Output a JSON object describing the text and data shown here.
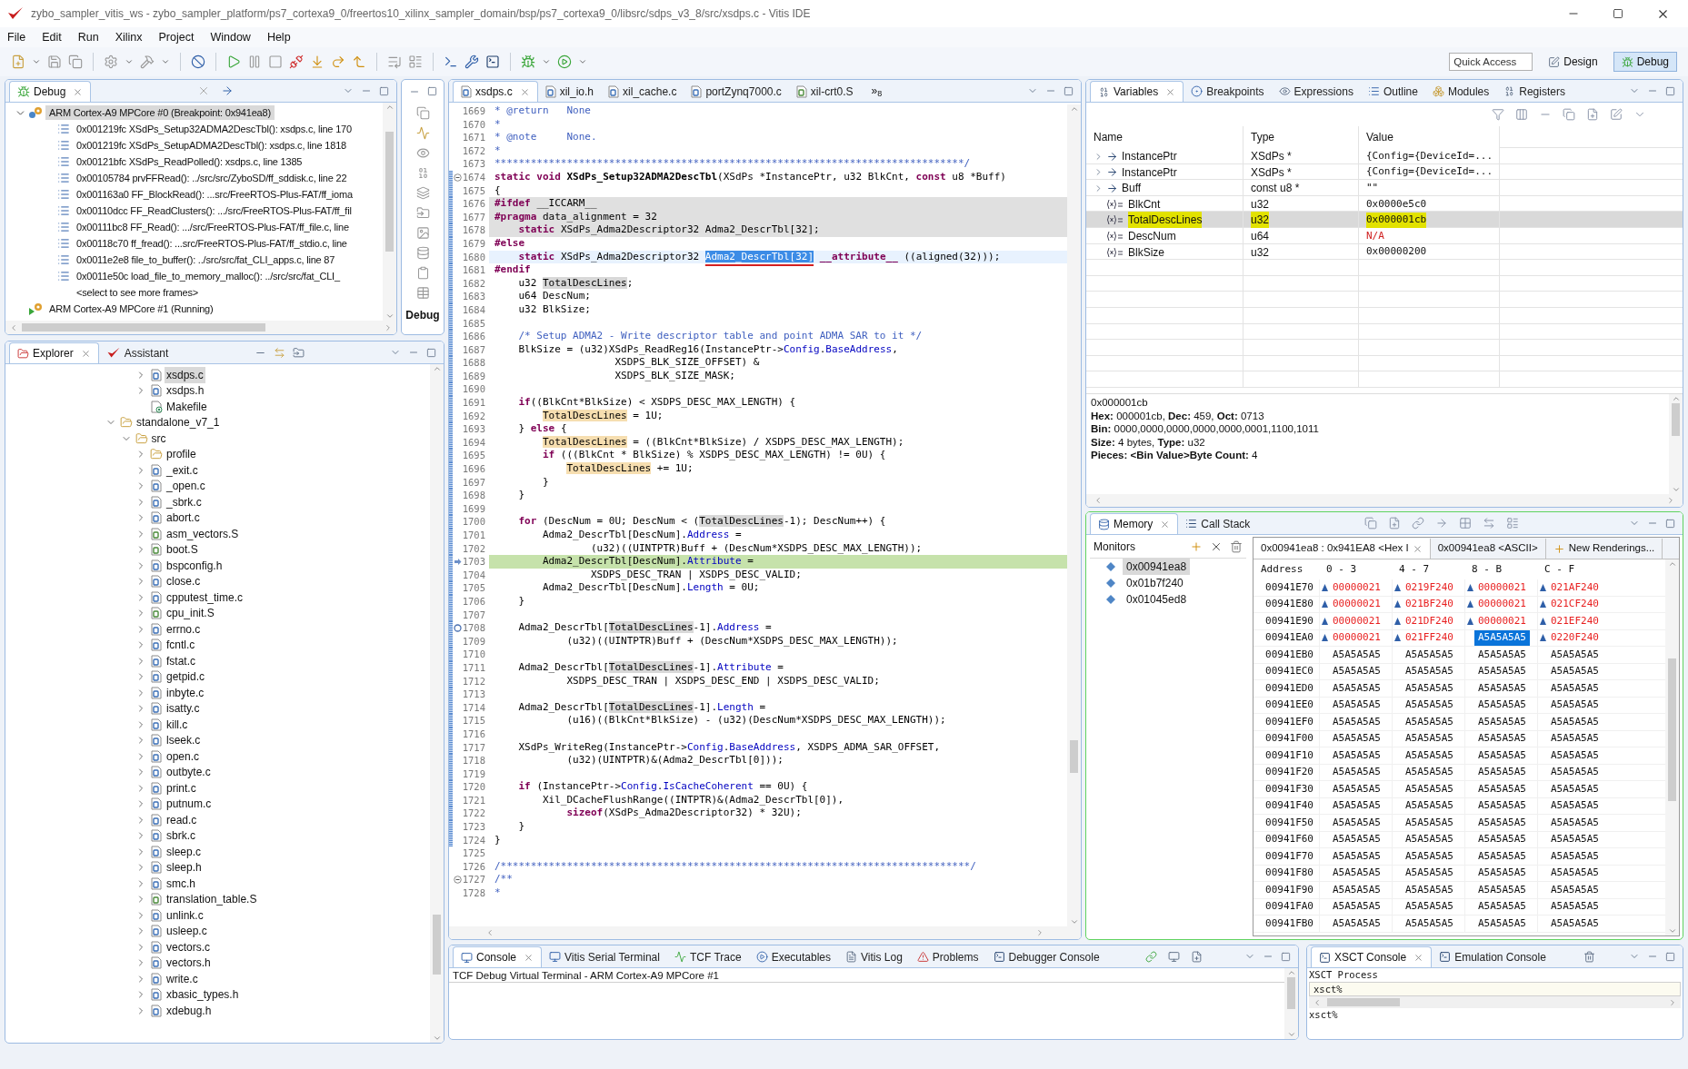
{
  "window": {
    "title": "zybo_sampler_vitis_ws - zybo_sampler_platform/ps7_cortexa9_0/freertos10_xilinx_sampler_domain/bsp/ps7_cortexa9_0/libsrc/sdps_v3_8/src/xsdps.c - Vitis IDE"
  },
  "menu": [
    "File",
    "Edit",
    "Run",
    "Xilinx",
    "Project",
    "Window",
    "Help"
  ],
  "toolbar": {
    "quick_access": "Quick Access",
    "perspectives": [
      {
        "label": "Design",
        "selected": false
      },
      {
        "label": "Debug",
        "selected": true
      }
    ]
  },
  "debug": {
    "tabs": [
      {
        "label": "Debug",
        "selected": true
      }
    ],
    "side_label": "Debug",
    "tree": [
      {
        "label": "ARM Cortex-A9 MPCore #0 (Breakpoint: 0x941ea8)",
        "kind": "suspended",
        "expanded": true,
        "selected": true,
        "children": [
          {
            "label": "0x001219fc XSdPs_Setup32ADMA2DescTbl(): xsdps.c, line 170",
            "kind": "frame",
            "selected": false
          },
          {
            "label": "0x001219fc XSdPs_SetupADMA2DescTbl(): xsdps.c, line 1818",
            "kind": "frame",
            "selected": false
          },
          {
            "label": "0x00121bfc XSdPs_ReadPolled(): xsdps.c, line 1385",
            "kind": "frame",
            "selected": false
          },
          {
            "label": "0x00105784 prvFFRead(): ../src/src/ZyboSD/ff_sddisk.c, line 22",
            "kind": "frame",
            "selected": false
          },
          {
            "label": "0x001163a0 FF_BlockRead(): ...src/FreeRTOS-Plus-FAT/ff_ioma",
            "kind": "frame",
            "selected": false
          },
          {
            "label": "0x00110dcc FF_ReadClusters(): .../src/FreeRTOS-Plus-FAT/ff_fil",
            "kind": "frame",
            "selected": false
          },
          {
            "label": "0x00111bc8 FF_Read(): .../src/FreeRTOS-Plus-FAT/ff_file.c, line",
            "kind": "frame",
            "selected": false
          },
          {
            "label": "0x00118c70 ff_fread(): ...src/FreeRTOS-Plus-FAT/ff_stdio.c, line",
            "kind": "frame",
            "selected": false
          },
          {
            "label": "0x0011e2e8 file_to_buffer(): ../src/src/fat_CLI_apps.c, line 87",
            "kind": "frame",
            "selected": false
          },
          {
            "label": "0x0011e50c load_file_to_memory_malloc(): ../src/src/fat_CLI_",
            "kind": "frame",
            "selected": false
          },
          {
            "label": "<select to see more frames>",
            "kind": "more",
            "selected": false
          }
        ]
      },
      {
        "label": "ARM Cortex-A9 MPCore #1 (Running)",
        "kind": "running",
        "selected": false
      }
    ]
  },
  "explorer": {
    "tabs": [
      {
        "label": "Explorer",
        "selected": true
      },
      {
        "label": "Assistant",
        "selected": false
      }
    ],
    "tree": [
      {
        "children": [
          {
            "children": [
              {
                "label": "xsdps.c",
                "kind": "source",
                "expanded": false,
                "selected": true
              },
              {
                "label": "xsdps.h",
                "kind": "header",
                "expanded": false,
                "selected": false
              },
              {
                "label": "Makefile",
                "kind": "makefile",
                "selected": false
              }
            ]
          }
        ]
      },
      {
        "label": "standalone_v7_1",
        "kind": "folder",
        "expanded": true,
        "selected": false,
        "children": [
          {
            "label": "src",
            "kind": "folder",
            "expanded": true,
            "selected": false,
            "children": [
              {
                "label": "profile",
                "kind": "folder",
                "expanded": false,
                "selected": false
              },
              {
                "label": "_exit.c",
                "kind": "source",
                "expanded": false,
                "selected": false
              },
              {
                "label": "_open.c",
                "kind": "source",
                "expanded": false,
                "selected": false
              },
              {
                "label": "_sbrk.c",
                "kind": "source",
                "expanded": false,
                "selected": false
              },
              {
                "label": "abort.c",
                "kind": "source",
                "expanded": false,
                "selected": false
              },
              {
                "label": "asm_vectors.S",
                "kind": "asm",
                "expanded": false,
                "selected": false
              },
              {
                "label": "boot.S",
                "kind": "asm",
                "expanded": false,
                "selected": false
              },
              {
                "label": "bspconfig.h",
                "kind": "header",
                "expanded": false,
                "selected": false
              },
              {
                "label": "close.c",
                "kind": "source",
                "expanded": false,
                "selected": false
              },
              {
                "label": "cpputest_time.c",
                "kind": "source",
                "expanded": false,
                "selected": false
              },
              {
                "label": "cpu_init.S",
                "kind": "asm",
                "expanded": false,
                "selected": false
              },
              {
                "label": "errno.c",
                "kind": "source",
                "expanded": false,
                "selected": false
              },
              {
                "label": "fcntl.c",
                "kind": "source",
                "expanded": false,
                "selected": false
              },
              {
                "label": "fstat.c",
                "kind": "source",
                "expanded": false,
                "selected": false
              },
              {
                "label": "getpid.c",
                "kind": "source",
                "expanded": false,
                "selected": false
              },
              {
                "label": "inbyte.c",
                "kind": "source",
                "expanded": false,
                "selected": false
              },
              {
                "label": "isatty.c",
                "kind": "source",
                "expanded": false,
                "selected": false
              },
              {
                "label": "kill.c",
                "kind": "source",
                "expanded": false,
                "selected": false
              },
              {
                "label": "lseek.c",
                "kind": "source",
                "expanded": false,
                "selected": false
              },
              {
                "label": "open.c",
                "kind": "source",
                "expanded": false,
                "selected": false
              },
              {
                "label": "outbyte.c",
                "kind": "source",
                "expanded": false,
                "selected": false
              },
              {
                "label": "print.c",
                "kind": "source",
                "expanded": false,
                "selected": false
              },
              {
                "label": "putnum.c",
                "kind": "source",
                "expanded": false,
                "selected": false
              },
              {
                "label": "read.c",
                "kind": "source",
                "expanded": false,
                "selected": false
              },
              {
                "label": "sbrk.c",
                "kind": "source",
                "expanded": false,
                "selected": false
              },
              {
                "label": "sleep.c",
                "kind": "source",
                "expanded": false,
                "selected": false
              },
              {
                "label": "sleep.h",
                "kind": "header",
                "expanded": false,
                "selected": false
              },
              {
                "label": "smc.h",
                "kind": "header",
                "expanded": false,
                "selected": false
              },
              {
                "label": "translation_table.S",
                "kind": "asm",
                "expanded": false,
                "selected": false
              },
              {
                "label": "unlink.c",
                "kind": "source",
                "expanded": false,
                "selected": false
              },
              {
                "label": "usleep.c",
                "kind": "source",
                "expanded": false,
                "selected": false
              },
              {
                "label": "vectors.c",
                "kind": "source",
                "expanded": false,
                "selected": false
              },
              {
                "label": "vectors.h",
                "kind": "header",
                "expanded": false,
                "selected": false
              },
              {
                "label": "write.c",
                "kind": "source",
                "expanded": false,
                "selected": false
              },
              {
                "label": "xbasic_types.h",
                "kind": "header",
                "expanded": false,
                "selected": false
              },
              {
                "label": "xdebug.h",
                "kind": "header",
                "expanded": false,
                "selected": false
              }
            ]
          }
        ]
      }
    ]
  },
  "editor": {
    "tabs": [
      {
        "label": "xsdps.c",
        "kind": "source",
        "selected": true
      },
      {
        "label": "xil_io.h",
        "kind": "header",
        "selected": false
      },
      {
        "label": "xil_cache.c",
        "kind": "source",
        "selected": false
      },
      {
        "label": "portZynq7000.c",
        "kind": "source",
        "selected": false
      },
      {
        "label": "xil-crt0.S",
        "kind": "asm",
        "selected": false
      }
    ],
    "overflow": {
      "mark": "»",
      "count": "8"
    },
    "lines": [
      {
        "n": "1669",
        "parts": [
          {
            "t": "* @return   None",
            "kind": "cm"
          }
        ]
      },
      {
        "n": "1670",
        "parts": [
          {
            "t": "*",
            "kind": "cm"
          }
        ]
      },
      {
        "n": "1671",
        "parts": [
          {
            "t": "* @note     None.",
            "kind": "cm"
          }
        ]
      },
      {
        "n": "1672",
        "parts": [
          {
            "t": "*",
            "kind": "cm"
          }
        ]
      },
      {
        "n": "1673",
        "parts": [
          {
            "t": "******************************************************************************/",
            "kind": "cm"
          }
        ]
      },
      {
        "n": "1674",
        "fold": true,
        "scope": true,
        "parts": [
          {
            "t": "static void ",
            "kind": "kw"
          },
          {
            "t": "XSdPs_Setup32ADMA2DescTbl",
            "kind": "fn"
          },
          {
            "t": "(XSdPs *InstancePtr, u32 BlkCnt, "
          },
          {
            "t": "const",
            "kind": "kw"
          },
          {
            "t": " u8 *Buff)"
          }
        ]
      },
      {
        "n": "1675",
        "scope": true,
        "parts": [
          {
            "t": "{"
          }
        ]
      },
      {
        "n": "1676",
        "scope": true,
        "inactive": true,
        "parts": [
          {
            "t": "#ifdef",
            "kind": "pp"
          },
          {
            "t": " __ICCARM__"
          }
        ]
      },
      {
        "n": "1677",
        "scope": true,
        "inactive": true,
        "parts": [
          {
            "t": "#pragma",
            "kind": "pp"
          },
          {
            "t": " data_alignment = 32"
          }
        ]
      },
      {
        "n": "1678",
        "scope": true,
        "inactive": true,
        "parts": [
          {
            "t": "    static",
            "kind": "kw"
          },
          {
            "t": " XSdPs_Adma2Descriptor32 Adma2_DescrTbl[32];"
          }
        ]
      },
      {
        "n": "1679",
        "scope": true,
        "parts": [
          {
            "t": "#else",
            "kind": "pp"
          }
        ]
      },
      {
        "n": "1680",
        "scope": true,
        "cursor": true,
        "parts": [
          {
            "t": "    static",
            "kind": "kw"
          },
          {
            "t": " XSdPs_Adma2Descriptor32 "
          },
          {
            "t": "Adma2_DescrTbl[32]",
            "kind": "sel",
            "underlined": true
          },
          {
            "t": " __attribute__",
            "kind": "kw"
          },
          {
            "t": " ((aligned(32)));"
          }
        ]
      },
      {
        "n": "1681",
        "scope": true,
        "parts": [
          {
            "t": "#endif",
            "kind": "pp"
          }
        ]
      },
      {
        "n": "1682",
        "scope": true,
        "parts": [
          {
            "t": "    u32 "
          },
          {
            "t": "TotalDescLines",
            "kind": "rd"
          },
          {
            "t": ";"
          }
        ]
      },
      {
        "n": "1683",
        "scope": true,
        "parts": [
          {
            "t": "    u64 DescNum;"
          }
        ]
      },
      {
        "n": "1684",
        "scope": true,
        "parts": [
          {
            "t": "    u32 BlkSize;"
          }
        ]
      },
      {
        "n": "1685",
        "scope": true
      },
      {
        "n": "1686",
        "scope": true,
        "parts": [
          {
            "t": "    /* Setup ADMA2 - Write descriptor table and point ADMA SAR to it */",
            "kind": "cm"
          }
        ]
      },
      {
        "n": "1687",
        "scope": true,
        "parts": [
          {
            "t": "    BlkSize = (u32)XSdPs_ReadReg16(InstancePtr->"
          },
          {
            "t": "Config",
            "kind": "fld"
          },
          {
            "t": "."
          },
          {
            "t": "BaseAddress",
            "kind": "fld"
          },
          {
            "t": ","
          }
        ]
      },
      {
        "n": "1688",
        "scope": true,
        "parts": [
          {
            "t": "                    XSDPS_BLK_SIZE_OFFSET) &"
          }
        ]
      },
      {
        "n": "1689",
        "scope": true,
        "parts": [
          {
            "t": "                    XSDPS_BLK_SIZE_MASK;"
          }
        ]
      },
      {
        "n": "1690",
        "scope": true
      },
      {
        "n": "1691",
        "scope": true,
        "parts": [
          {
            "t": "    if",
            "kind": "kw"
          },
          {
            "t": "((BlkCnt*BlkSize) < XSDPS_DESC_MAX_LENGTH) {"
          }
        ]
      },
      {
        "n": "1692",
        "scope": true,
        "parts": [
          {
            "t": "        TotalDescLines",
            "kind": "occ"
          },
          {
            "t": " = 1U;"
          }
        ]
      },
      {
        "n": "1693",
        "scope": true,
        "parts": [
          {
            "t": "    } "
          },
          {
            "t": "else",
            "kind": "kw"
          },
          {
            "t": " {"
          }
        ]
      },
      {
        "n": "1694",
        "scope": true,
        "parts": [
          {
            "t": "        TotalDescLines",
            "kind": "occ"
          },
          {
            "t": " = ((BlkCnt*BlkSize) / XSDPS_DESC_MAX_LENGTH);"
          }
        ]
      },
      {
        "n": "1695",
        "scope": true,
        "parts": [
          {
            "t": "        if",
            "kind": "kw"
          },
          {
            "t": " (((BlkCnt * BlkSize) % XSDPS_DESC_MAX_LENGTH) != 0U) {"
          }
        ]
      },
      {
        "n": "1696",
        "scope": true,
        "parts": [
          {
            "t": "            TotalDescLines",
            "kind": "occ"
          },
          {
            "t": " += 1U;"
          }
        ]
      },
      {
        "n": "1697",
        "scope": true,
        "parts": [
          {
            "t": "        }"
          }
        ]
      },
      {
        "n": "1698",
        "scope": true,
        "parts": [
          {
            "t": "    }"
          }
        ]
      },
      {
        "n": "1699",
        "scope": true
      },
      {
        "n": "1700",
        "scope": true,
        "parts": [
          {
            "t": "    for",
            "kind": "kw"
          },
          {
            "t": " (DescNum = 0U; DescNum < ("
          },
          {
            "t": "TotalDescLines",
            "kind": "rd"
          },
          {
            "t": "-1); DescNum++) {"
          }
        ]
      },
      {
        "n": "1701",
        "scope": true,
        "parts": [
          {
            "t": "        Adma2_DescrTbl[DescNum]."
          },
          {
            "t": "Address",
            "kind": "fld"
          },
          {
            "t": " ="
          }
        ]
      },
      {
        "n": "1702",
        "scope": true,
        "parts": [
          {
            "t": "                (u32)((UINTPTR)Buff + (DescNum*XSDPS_DESC_MAX_LENGTH));"
          }
        ]
      },
      {
        "n": "1703",
        "scope": true,
        "pointer": true,
        "current": true,
        "parts": [
          {
            "t": "        Adma2_DescrTbl[DescNum]."
          },
          {
            "t": "Attribute",
            "kind": "fld"
          },
          {
            "t": " ="
          }
        ]
      },
      {
        "n": "1704",
        "scope": true,
        "parts": [
          {
            "t": "                XSDPS_DESC_TRAN | XSDPS_DESC_VALID;"
          }
        ]
      },
      {
        "n": "1705",
        "scope": true,
        "parts": [
          {
            "t": "        Adma2_DescrTbl[DescNum]."
          },
          {
            "t": "Length",
            "kind": "fld"
          },
          {
            "t": " = 0U;"
          }
        ]
      },
      {
        "n": "1706",
        "scope": true,
        "parts": [
          {
            "t": "    }"
          }
        ]
      },
      {
        "n": "1707",
        "scope": true
      },
      {
        "n": "1708",
        "scope": true,
        "breakpoint": true,
        "parts": [
          {
            "t": "    Adma2_DescrTbl["
          },
          {
            "t": "TotalDescLines",
            "kind": "rd"
          },
          {
            "t": "-1]."
          },
          {
            "t": "Address",
            "kind": "fld"
          },
          {
            "t": " ="
          }
        ]
      },
      {
        "n": "1709",
        "scope": true,
        "parts": [
          {
            "t": "            (u32)((UINTPTR)Buff + (DescNum*XSDPS_DESC_MAX_LENGTH));"
          }
        ]
      },
      {
        "n": "1710",
        "scope": true
      },
      {
        "n": "1711",
        "scope": true,
        "parts": [
          {
            "t": "    Adma2_DescrTbl["
          },
          {
            "t": "TotalDescLines",
            "kind": "rd"
          },
          {
            "t": "-1]."
          },
          {
            "t": "Attribute",
            "kind": "fld"
          },
          {
            "t": " ="
          }
        ]
      },
      {
        "n": "1712",
        "scope": true,
        "parts": [
          {
            "t": "            XSDPS_DESC_TRAN | XSDPS_DESC_END | XSDPS_DESC_VALID;"
          }
        ]
      },
      {
        "n": "1713",
        "scope": true
      },
      {
        "n": "1714",
        "scope": true,
        "parts": [
          {
            "t": "    Adma2_DescrTbl["
          },
          {
            "t": "TotalDescLines",
            "kind": "rd"
          },
          {
            "t": "-1]."
          },
          {
            "t": "Length",
            "kind": "fld"
          },
          {
            "t": " ="
          }
        ]
      },
      {
        "n": "1715",
        "scope": true,
        "parts": [
          {
            "t": "            (u16)((BlkCnt*BlkSize) - (u32)(DescNum*XSDPS_DESC_MAX_LENGTH));"
          }
        ]
      },
      {
        "n": "1716",
        "scope": true
      },
      {
        "n": "1717",
        "scope": true,
        "parts": [
          {
            "t": "    XSdPs_WriteReg(InstancePtr->"
          },
          {
            "t": "Config",
            "kind": "fld"
          },
          {
            "t": "."
          },
          {
            "t": "BaseAddress",
            "kind": "fld"
          },
          {
            "t": ", XSDPS_ADMA_SAR_OFFSET,"
          }
        ]
      },
      {
        "n": "1718",
        "scope": true,
        "parts": [
          {
            "t": "            (u32)(UINTPTR)&(Adma2_DescrTbl[0]));"
          }
        ]
      },
      {
        "n": "1719",
        "scope": true
      },
      {
        "n": "1720",
        "scope": true,
        "parts": [
          {
            "t": "    if",
            "kind": "kw"
          },
          {
            "t": " (InstancePtr->"
          },
          {
            "t": "Config",
            "kind": "fld"
          },
          {
            "t": "."
          },
          {
            "t": "IsCacheCoherent",
            "kind": "fld"
          },
          {
            "t": " == 0U) {"
          }
        ]
      },
      {
        "n": "1721",
        "scope": true,
        "parts": [
          {
            "t": "        Xil_DCacheFlushRange((INTPTR)&(Adma2_DescrTbl[0]),"
          }
        ]
      },
      {
        "n": "1722",
        "scope": true,
        "parts": [
          {
            "t": "            sizeof",
            "kind": "kw"
          },
          {
            "t": "(XSdPs_Adma2Descriptor32) * 32U);"
          }
        ]
      },
      {
        "n": "1723",
        "scope": true,
        "parts": [
          {
            "t": "    }"
          }
        ]
      },
      {
        "n": "1724",
        "scope": true,
        "parts": [
          {
            "t": "}"
          }
        ]
      },
      {
        "n": "1725"
      },
      {
        "n": "1726",
        "parts": [
          {
            "t": "/******************************************************************************/",
            "kind": "cm"
          }
        ]
      },
      {
        "n": "1727",
        "fold": true,
        "parts": [
          {
            "t": "/**",
            "kind": "cm"
          }
        ]
      },
      {
        "n": "1728",
        "parts": [
          {
            "t": "*",
            "kind": "cm"
          }
        ]
      }
    ]
  },
  "variables": {
    "tabs": [
      {
        "label": "Variables",
        "selected": true
      },
      {
        "label": "Breakpoints",
        "selected": false
      },
      {
        "label": "Expressions",
        "selected": false
      },
      {
        "label": "Outline",
        "selected": false
      },
      {
        "label": "Modules",
        "selected": false
      },
      {
        "label": "Registers",
        "selected": false
      }
    ],
    "columns": [
      "Name",
      "Type",
      "Value"
    ],
    "rows": [
      {
        "name": "InstancePtr",
        "type": "XSdPs *",
        "value": "{Config={DeviceId=...",
        "kind": "pointer",
        "expanded": false,
        "selected": false,
        "marked": false,
        "error": false
      },
      {
        "name": "InstancePtr",
        "type": "XSdPs *",
        "value": "{Config={DeviceId=...",
        "kind": "pointer",
        "expanded": false,
        "selected": false,
        "marked": false,
        "error": false
      },
      {
        "name": "Buff",
        "type": "const u8 *",
        "value": "\"\"",
        "kind": "pointer",
        "expanded": false,
        "selected": false,
        "marked": false,
        "error": false
      },
      {
        "name": "BlkCnt",
        "type": "u32",
        "value": "0x0000e5c0",
        "kind": "scalar",
        "selected": false,
        "marked": false,
        "error": false
      },
      {
        "name": "TotalDescLines",
        "type": "u32",
        "value": "0x000001cb",
        "kind": "scalar",
        "selected": true,
        "marked": true,
        "error": false
      },
      {
        "name": "DescNum",
        "type": "u64",
        "value": "N/A",
        "kind": "scalar",
        "selected": false,
        "marked": false,
        "error": true
      },
      {
        "name": "BlkSize",
        "type": "u32",
        "value": "0x00000200",
        "kind": "scalar",
        "selected": false,
        "marked": false,
        "error": false
      }
    ],
    "details": [
      "0x000001cb",
      "**Hex:** 000001cb, **Dec:** 459, **Oct:** 0713",
      "**Bin:** 0000,0000,0000,0000,0000,0001,1100,1011",
      "**Size:** 4 bytes, **Type:** u32",
      "**Pieces: <Bin Value>Byte Count:** 4"
    ]
  },
  "memory": {
    "active": true,
    "tabs": [
      {
        "label": "Memory",
        "selected": true
      },
      {
        "label": "Call Stack",
        "selected": false
      }
    ],
    "monitors_label": "Monitors",
    "monitors": [
      {
        "label": "0x00941ea8",
        "selected": true
      },
      {
        "label": "0x01b7f240",
        "selected": false
      },
      {
        "label": "0x01045ed8",
        "selected": false
      }
    ],
    "renderings": [
      {
        "label": "0x00941ea8 : 0x941EA8 <Hex I",
        "kind": "rendering",
        "selected": true
      },
      {
        "label": "0x00941ea8 <ASCII>",
        "kind": "rendering",
        "selected": false
      },
      {
        "label": "New Renderings...",
        "kind": "add",
        "selected": false
      }
    ],
    "address_column": "Address",
    "columns": [
      "0 - 3",
      "4 - 7",
      "8 - B",
      "C - F"
    ],
    "rows": [
      {
        "address": "00941E70",
        "cells": [
          {
            "text": "00000021",
            "changed": true,
            "selected": false
          },
          {
            "text": "0219F240",
            "changed": true,
            "selected": false
          },
          {
            "text": "00000021",
            "changed": true,
            "selected": false
          },
          {
            "text": "021AF240",
            "changed": true,
            "selected": false
          }
        ]
      },
      {
        "address": "00941E80",
        "cells": [
          {
            "text": "00000021",
            "changed": true,
            "selected": false
          },
          {
            "text": "021BF240",
            "changed": true,
            "selected": false
          },
          {
            "text": "00000021",
            "changed": true,
            "selected": false
          },
          {
            "text": "021CF240",
            "changed": true,
            "selected": false
          }
        ]
      },
      {
        "address": "00941E90",
        "cells": [
          {
            "text": "00000021",
            "changed": true,
            "selected": false
          },
          {
            "text": "021DF240",
            "changed": true,
            "selected": false
          },
          {
            "text": "00000021",
            "changed": true,
            "selected": false
          },
          {
            "text": "021EF240",
            "changed": true,
            "selected": false
          }
        ]
      },
      {
        "address": "00941EA0",
        "cells": [
          {
            "text": "00000021",
            "changed": true,
            "selected": false
          },
          {
            "text": "021FF240",
            "changed": true,
            "selected": false
          },
          {
            "text": "A5A5A5A5",
            "changed": false,
            "selected": true
          },
          {
            "text": "0220F240",
            "changed": true,
            "selected": false
          }
        ]
      },
      {
        "address": "00941EB0",
        "cells": [
          {
            "text": "A5A5A5A5",
            "changed": false,
            "selected": false
          },
          {
            "text": "A5A5A5A5",
            "changed": false,
            "selected": false
          },
          {
            "text": "A5A5A5A5",
            "changed": false,
            "selected": false
          },
          {
            "text": "A5A5A5A5",
            "changed": false,
            "selected": false
          }
        ]
      },
      {
        "address": "00941EC0",
        "cells": [
          {
            "text": "A5A5A5A5",
            "changed": false,
            "selected": false
          },
          {
            "text": "A5A5A5A5",
            "changed": false,
            "selected": false
          },
          {
            "text": "A5A5A5A5",
            "changed": false,
            "selected": false
          },
          {
            "text": "A5A5A5A5",
            "changed": false,
            "selected": false
          }
        ]
      },
      {
        "address": "00941ED0",
        "cells": [
          {
            "text": "A5A5A5A5",
            "changed": false,
            "selected": false
          },
          {
            "text": "A5A5A5A5",
            "changed": false,
            "selected": false
          },
          {
            "text": "A5A5A5A5",
            "changed": false,
            "selected": false
          },
          {
            "text": "A5A5A5A5",
            "changed": false,
            "selected": false
          }
        ]
      },
      {
        "address": "00941EE0",
        "cells": [
          {
            "text": "A5A5A5A5",
            "changed": false,
            "selected": false
          },
          {
            "text": "A5A5A5A5",
            "changed": false,
            "selected": false
          },
          {
            "text": "A5A5A5A5",
            "changed": false,
            "selected": false
          },
          {
            "text": "A5A5A5A5",
            "changed": false,
            "selected": false
          }
        ]
      },
      {
        "address": "00941EF0",
        "cells": [
          {
            "text": "A5A5A5A5",
            "changed": false,
            "selected": false
          },
          {
            "text": "A5A5A5A5",
            "changed": false,
            "selected": false
          },
          {
            "text": "A5A5A5A5",
            "changed": false,
            "selected": false
          },
          {
            "text": "A5A5A5A5",
            "changed": false,
            "selected": false
          }
        ]
      },
      {
        "address": "00941F00",
        "cells": [
          {
            "text": "A5A5A5A5",
            "changed": false,
            "selected": false
          },
          {
            "text": "A5A5A5A5",
            "changed": false,
            "selected": false
          },
          {
            "text": "A5A5A5A5",
            "changed": false,
            "selected": false
          },
          {
            "text": "A5A5A5A5",
            "changed": false,
            "selected": false
          }
        ]
      },
      {
        "address": "00941F10",
        "cells": [
          {
            "text": "A5A5A5A5",
            "changed": false,
            "selected": false
          },
          {
            "text": "A5A5A5A5",
            "changed": false,
            "selected": false
          },
          {
            "text": "A5A5A5A5",
            "changed": false,
            "selected": false
          },
          {
            "text": "A5A5A5A5",
            "changed": false,
            "selected": false
          }
        ]
      },
      {
        "address": "00941F20",
        "cells": [
          {
            "text": "A5A5A5A5",
            "changed": false,
            "selected": false
          },
          {
            "text": "A5A5A5A5",
            "changed": false,
            "selected": false
          },
          {
            "text": "A5A5A5A5",
            "changed": false,
            "selected": false
          },
          {
            "text": "A5A5A5A5",
            "changed": false,
            "selected": false
          }
        ]
      },
      {
        "address": "00941F30",
        "cells": [
          {
            "text": "A5A5A5A5",
            "changed": false,
            "selected": false
          },
          {
            "text": "A5A5A5A5",
            "changed": false,
            "selected": false
          },
          {
            "text": "A5A5A5A5",
            "changed": false,
            "selected": false
          },
          {
            "text": "A5A5A5A5",
            "changed": false,
            "selected": false
          }
        ]
      },
      {
        "address": "00941F40",
        "cells": [
          {
            "text": "A5A5A5A5",
            "changed": false,
            "selected": false
          },
          {
            "text": "A5A5A5A5",
            "changed": false,
            "selected": false
          },
          {
            "text": "A5A5A5A5",
            "changed": false,
            "selected": false
          },
          {
            "text": "A5A5A5A5",
            "changed": false,
            "selected": false
          }
        ]
      },
      {
        "address": "00941F50",
        "cells": [
          {
            "text": "A5A5A5A5",
            "changed": false,
            "selected": false
          },
          {
            "text": "A5A5A5A5",
            "changed": false,
            "selected": false
          },
          {
            "text": "A5A5A5A5",
            "changed": false,
            "selected": false
          },
          {
            "text": "A5A5A5A5",
            "changed": false,
            "selected": false
          }
        ]
      },
      {
        "address": "00941F60",
        "cells": [
          {
            "text": "A5A5A5A5",
            "changed": false,
            "selected": false
          },
          {
            "text": "A5A5A5A5",
            "changed": false,
            "selected": false
          },
          {
            "text": "A5A5A5A5",
            "changed": false,
            "selected": false
          },
          {
            "text": "A5A5A5A5",
            "changed": false,
            "selected": false
          }
        ]
      },
      {
        "address": "00941F70",
        "cells": [
          {
            "text": "A5A5A5A5",
            "changed": false,
            "selected": false
          },
          {
            "text": "A5A5A5A5",
            "changed": false,
            "selected": false
          },
          {
            "text": "A5A5A5A5",
            "changed": false,
            "selected": false
          },
          {
            "text": "A5A5A5A5",
            "changed": false,
            "selected": false
          }
        ]
      },
      {
        "address": "00941F80",
        "cells": [
          {
            "text": "A5A5A5A5",
            "changed": false,
            "selected": false
          },
          {
            "text": "A5A5A5A5",
            "changed": false,
            "selected": false
          },
          {
            "text": "A5A5A5A5",
            "changed": false,
            "selected": false
          },
          {
            "text": "A5A5A5A5",
            "changed": false,
            "selected": false
          }
        ]
      },
      {
        "address": "00941F90",
        "cells": [
          {
            "text": "A5A5A5A5",
            "changed": false,
            "selected": false
          },
          {
            "text": "A5A5A5A5",
            "changed": false,
            "selected": false
          },
          {
            "text": "A5A5A5A5",
            "changed": false,
            "selected": false
          },
          {
            "text": "A5A5A5A5",
            "changed": false,
            "selected": false
          }
        ]
      },
      {
        "address": "00941FA0",
        "cells": [
          {
            "text": "A5A5A5A5",
            "changed": false,
            "selected": false
          },
          {
            "text": "A5A5A5A5",
            "changed": false,
            "selected": false
          },
          {
            "text": "A5A5A5A5",
            "changed": false,
            "selected": false
          },
          {
            "text": "A5A5A5A5",
            "changed": false,
            "selected": false
          }
        ]
      },
      {
        "address": "00941FB0",
        "cells": [
          {
            "text": "A5A5A5A5",
            "changed": false,
            "selected": false
          },
          {
            "text": "A5A5A5A5",
            "changed": false,
            "selected": false
          },
          {
            "text": "A5A5A5A5",
            "changed": false,
            "selected": false
          },
          {
            "text": "A5A5A5A5",
            "changed": false,
            "selected": false
          }
        ]
      }
    ]
  },
  "console": {
    "tabs": [
      {
        "label": "Console",
        "selected": true
      },
      {
        "label": "Vitis Serial Terminal",
        "selected": false
      },
      {
        "label": "TCF Trace",
        "selected": false
      },
      {
        "label": "Executables",
        "selected": false
      },
      {
        "label": "Vitis Log",
        "selected": false
      },
      {
        "label": "Problems",
        "selected": false
      },
      {
        "label": "Debugger Console",
        "selected": false
      }
    ],
    "text": "TCF Debug Virtual Terminal - ARM Cortex-A9 MPCore #1"
  },
  "xsct": {
    "tabs": [
      {
        "label": "XSCT Console",
        "selected": true
      },
      {
        "label": "Emulation Console",
        "selected": false
      }
    ],
    "title": "XSCT Process",
    "input": "xsct%",
    "output": "xsct%"
  }
}
